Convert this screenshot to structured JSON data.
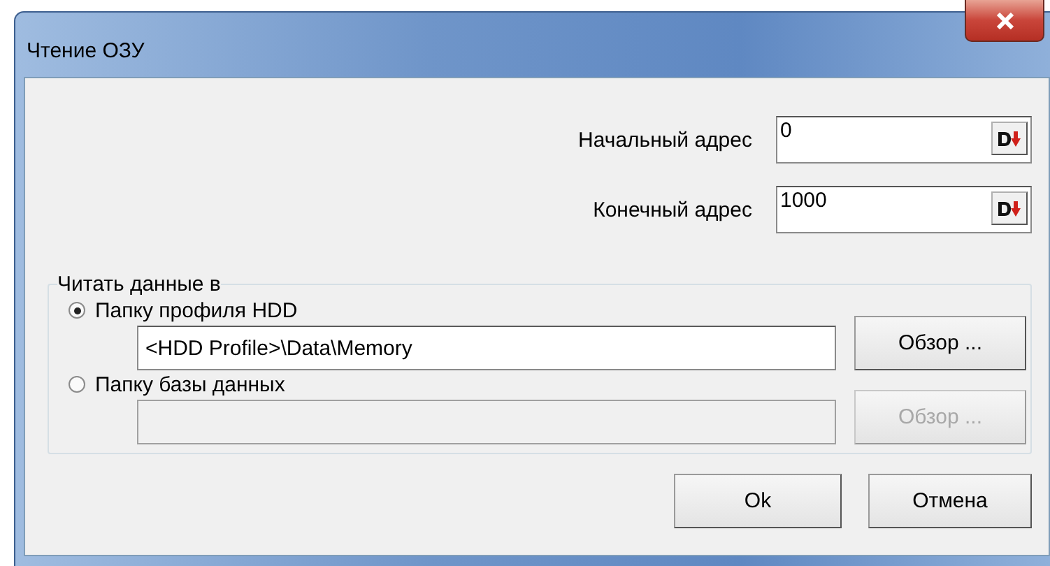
{
  "window": {
    "title": "Чтение ОЗУ"
  },
  "addresses": [
    {
      "label": "Начальный адрес",
      "value": "0"
    },
    {
      "label": "Конечный адрес",
      "value": "1000"
    }
  ],
  "read_to": {
    "legend": "Читать данные в",
    "options": [
      {
        "label": "Папку профиля HDD",
        "selected": true,
        "path": "<HDD Profile>\\Data\\Memory",
        "browse": "Обзор ...",
        "disabled": false
      },
      {
        "label": "Папку базы данных",
        "selected": false,
        "browse": "Обзор ...",
        "disabled": true
      }
    ]
  },
  "buttons": [
    "Ok",
    "Отмена"
  ]
}
